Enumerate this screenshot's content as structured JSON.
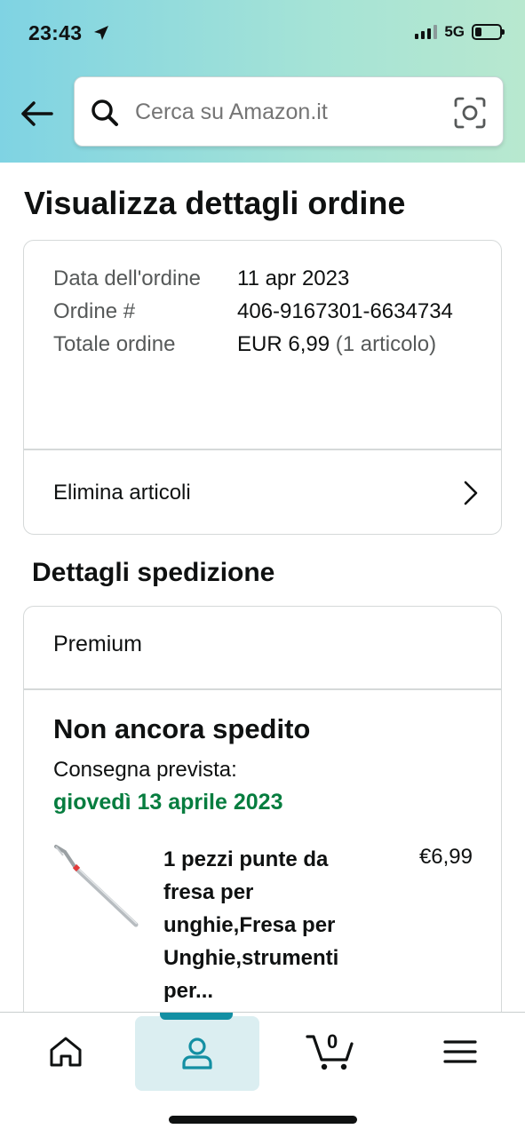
{
  "status_bar": {
    "time": "23:43",
    "network": "5G",
    "icons": [
      "location-arrow-icon",
      "signal-bars-icon",
      "battery-icon"
    ]
  },
  "search": {
    "placeholder": "Cerca su Amazon.it",
    "icons": [
      "back-arrow-icon",
      "search-icon",
      "camera-icon"
    ]
  },
  "page": {
    "title": "Visualizza dettagli ordine"
  },
  "order": {
    "date_label": "Data dell'ordine",
    "date_value": "11 apr 2023",
    "number_label": "Ordine #",
    "number_value": "406-9167301-6634734",
    "total_label": "Totale ordine",
    "total_value": "EUR 6,99",
    "total_items": "(1 articolo)",
    "delete_link": "Elimina articoli"
  },
  "shipping": {
    "section_title": "Dettagli spedizione",
    "type": "Premium",
    "status": "Non ancora spedito",
    "expected_label": "Consegna prevista:",
    "expected_date": "giovedì 13 aprile 2023",
    "date_color": "#067d3f"
  },
  "product": {
    "title": "1 pezzi punte da fresa per unghie,Fresa per Unghie,strumenti per...",
    "price": "€6,99",
    "image": "nail-drill-bit-image"
  },
  "bottom_nav": {
    "items": [
      "home-icon",
      "account-icon",
      "cart-icon",
      "menu-icon"
    ],
    "cart_count": "0",
    "active": "account",
    "accent": "#138fa3"
  }
}
